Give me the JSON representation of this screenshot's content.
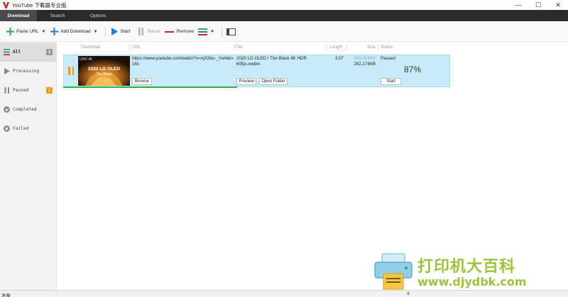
{
  "app": {
    "title": "YouTube 下載器专业版",
    "brand_color": "#d41c1c"
  },
  "window_controls": {
    "minimize": "—",
    "maximize": "☐",
    "close": "✕"
  },
  "tabs": [
    {
      "label": "Download",
      "active": true
    },
    {
      "label": "Search",
      "active": false
    },
    {
      "label": "Options",
      "active": false
    }
  ],
  "toolbar": {
    "paste_url": "Paste URL",
    "add_download": "Add Download",
    "start": "Start",
    "pause": "Pause",
    "remove": "Remove"
  },
  "sidebar": {
    "items": [
      {
        "label": "All",
        "badge": "1",
        "icon": "list-icon"
      },
      {
        "label": "Processing",
        "badge": "",
        "icon": "play-icon"
      },
      {
        "label": "Paused",
        "badge": "1",
        "icon": "pause-icon"
      },
      {
        "label": "Completed",
        "badge": "",
        "icon": "check-circle-icon"
      },
      {
        "label": "Failed",
        "badge": "",
        "icon": "x-circle-icon"
      }
    ]
  },
  "columns": {
    "thumbnail": "Thumbnail",
    "url": "URL",
    "file": "File",
    "length": "Length",
    "size": "Size",
    "status": "Status"
  },
  "download": {
    "thumbnail_badge": "UHD 4K",
    "thumbnail_line1": "2020 LG OLED",
    "thumbnail_line2": "The Black",
    "url": "https://www.youtube.com/watch?v=njX2bu-_Vw4&t=16s",
    "file": "2020 LG OLED l The Black 4K HDR 60fps.webm",
    "length": "2:07",
    "size_total": "326,854KB",
    "size_done": "282,174KB",
    "status": "Paused",
    "percent": "87%",
    "progress": 0.87,
    "browse_label": "Browse",
    "preview_label": "Preview",
    "open_folder_label": "Open Folder",
    "start_label": "Start"
  },
  "statusbar": {
    "left": "准备",
    "right": "d"
  },
  "watermark": {
    "top": "打印机大百科",
    "bottom": "www.djydbk.com"
  }
}
